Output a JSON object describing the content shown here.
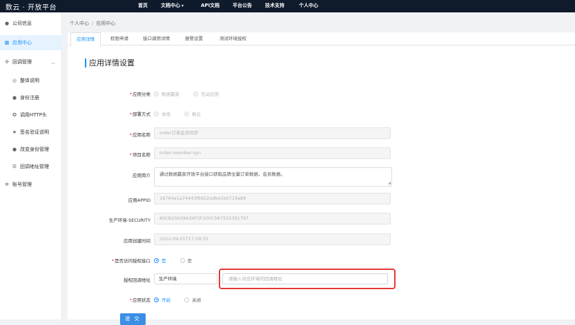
{
  "header": {
    "logo": "数云 · 开放平台",
    "nav": [
      {
        "label": "首页",
        "caret": false
      },
      {
        "label": "文档中心",
        "caret": true
      },
      {
        "label": "API文档",
        "caret": false
      },
      {
        "label": "平台公告",
        "caret": false
      },
      {
        "label": "技术支持",
        "caret": false
      },
      {
        "label": "个人中心",
        "caret": false
      }
    ]
  },
  "sidebar": {
    "items": [
      {
        "label": "公司信息",
        "icon": "info-icon",
        "active": false,
        "indent": false
      },
      {
        "label": "应用中心",
        "icon": "grid-icon",
        "active": true,
        "indent": false
      },
      {
        "label": "回调管理",
        "icon": "callback-icon",
        "active": false,
        "indent": false,
        "expanded": true
      },
      {
        "label": "整体说明",
        "icon": "globe-icon",
        "active": false,
        "indent": true
      },
      {
        "label": "身份注册",
        "icon": "user-icon",
        "active": false,
        "indent": true
      },
      {
        "label": "调用HTTP头",
        "icon": "settings-icon",
        "active": false,
        "indent": true
      },
      {
        "label": "签名验证说明",
        "icon": "star-icon",
        "active": false,
        "indent": true
      },
      {
        "label": "改变身份管理",
        "icon": "user-icon",
        "active": false,
        "indent": true
      },
      {
        "label": "回调地址管理",
        "icon": "list-icon",
        "active": false,
        "indent": true
      },
      {
        "label": "账号管理",
        "icon": "gear-icon",
        "active": false,
        "indent": false
      }
    ]
  },
  "breadcrumb": {
    "parent": "个人中心",
    "sep": "/",
    "current": "应用中心"
  },
  "tabs": [
    {
      "label": "应用详情",
      "active": true
    },
    {
      "label": "权限申请",
      "active": false
    },
    {
      "label": "接口调用详情",
      "active": false
    },
    {
      "label": "报警设置",
      "active": false
    },
    {
      "label": "测试环境授权",
      "active": false
    }
  ],
  "form": {
    "title": "应用详情设置",
    "app_category": {
      "label": "应用分类",
      "required": true,
      "options": [
        "数据赢家",
        "互动应用"
      ]
    },
    "deploy_mode": {
      "label": "部署方式",
      "required": true,
      "options": [
        "本地",
        "数云"
      ]
    },
    "app_name": {
      "label": "应用名称",
      "required": true,
      "value": "order订单会员同步"
    },
    "project_name": {
      "label": "项目名称",
      "required": true,
      "value": "order-member-syn"
    },
    "app_intro": {
      "label": "应用简介",
      "required": false,
      "value": "通过数据赢家开放平台接口获取品牌全量订单数据，会员数据。"
    },
    "app_id": {
      "label": "应用APPID",
      "required": false,
      "value": "16794a1a74443f6922adbe1b0716ab9"
    },
    "security": {
      "label": "生产环境-SECURITY",
      "required": false,
      "value": "80CB20A38A36F2F200C587555361797"
    },
    "created_time": {
      "label": "应用创建时间",
      "required": false,
      "value": "2022-09-01T17:09:55"
    },
    "authorize_api": {
      "label": "是否访问授权接口",
      "required": true,
      "options": [
        "是",
        "否"
      ],
      "selected": "是"
    },
    "callback_url": {
      "label": "授权回调地址",
      "required": false,
      "env_value": "生产环境",
      "placeholder": "请输入对应环境的回调地址"
    },
    "app_status": {
      "label": "应用状态",
      "required": true,
      "options": [
        "开启",
        "关闭"
      ],
      "selected": "开启"
    },
    "submit_label": "提 交"
  }
}
